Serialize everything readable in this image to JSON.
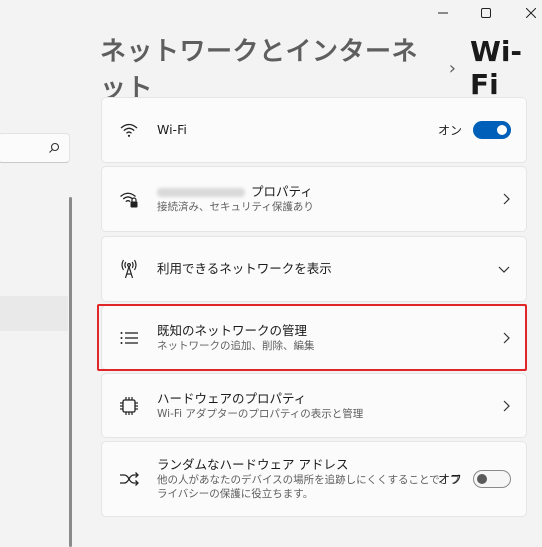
{
  "window": {
    "minimize_glyph": "—",
    "maximize_glyph": "☐",
    "close_glyph": "✕"
  },
  "breadcrumb": {
    "parent": "ネットワークとインターネット",
    "separator": "›",
    "current": "Wi-Fi"
  },
  "settings": {
    "wifi": {
      "title": "Wi-Fi",
      "toggle_label": "オン",
      "toggle_on": true,
      "icon": "wifi-icon"
    },
    "properties": {
      "title": "プロパティ",
      "subtitle": "接続済み、セキュリティ保護あり",
      "icon": "wifi-lock-icon"
    },
    "available": {
      "title": "利用できるネットワークを表示",
      "icon": "antenna-icon"
    },
    "known": {
      "title": "既知のネットワークの管理",
      "subtitle": "ネットワークの追加、削除、編集",
      "icon": "list-icon"
    },
    "hardware": {
      "title": "ハードウェアのプロパティ",
      "subtitle": "Wi-Fi アダプターのプロパティの表示と管理",
      "icon": "chip-icon"
    },
    "random": {
      "title": "ランダムなハードウェア アドレス",
      "subtitle_line1": "他の人があなたのデバイスの場所を追跡しにくくすることで、プ",
      "subtitle_line2": "ライバシーの保護に役立ちます。",
      "toggle_label": "オフ",
      "toggle_on": false,
      "icon": "shuffle-icon"
    }
  },
  "colors": {
    "accent": "#005fb8",
    "highlight": "#e02626"
  }
}
